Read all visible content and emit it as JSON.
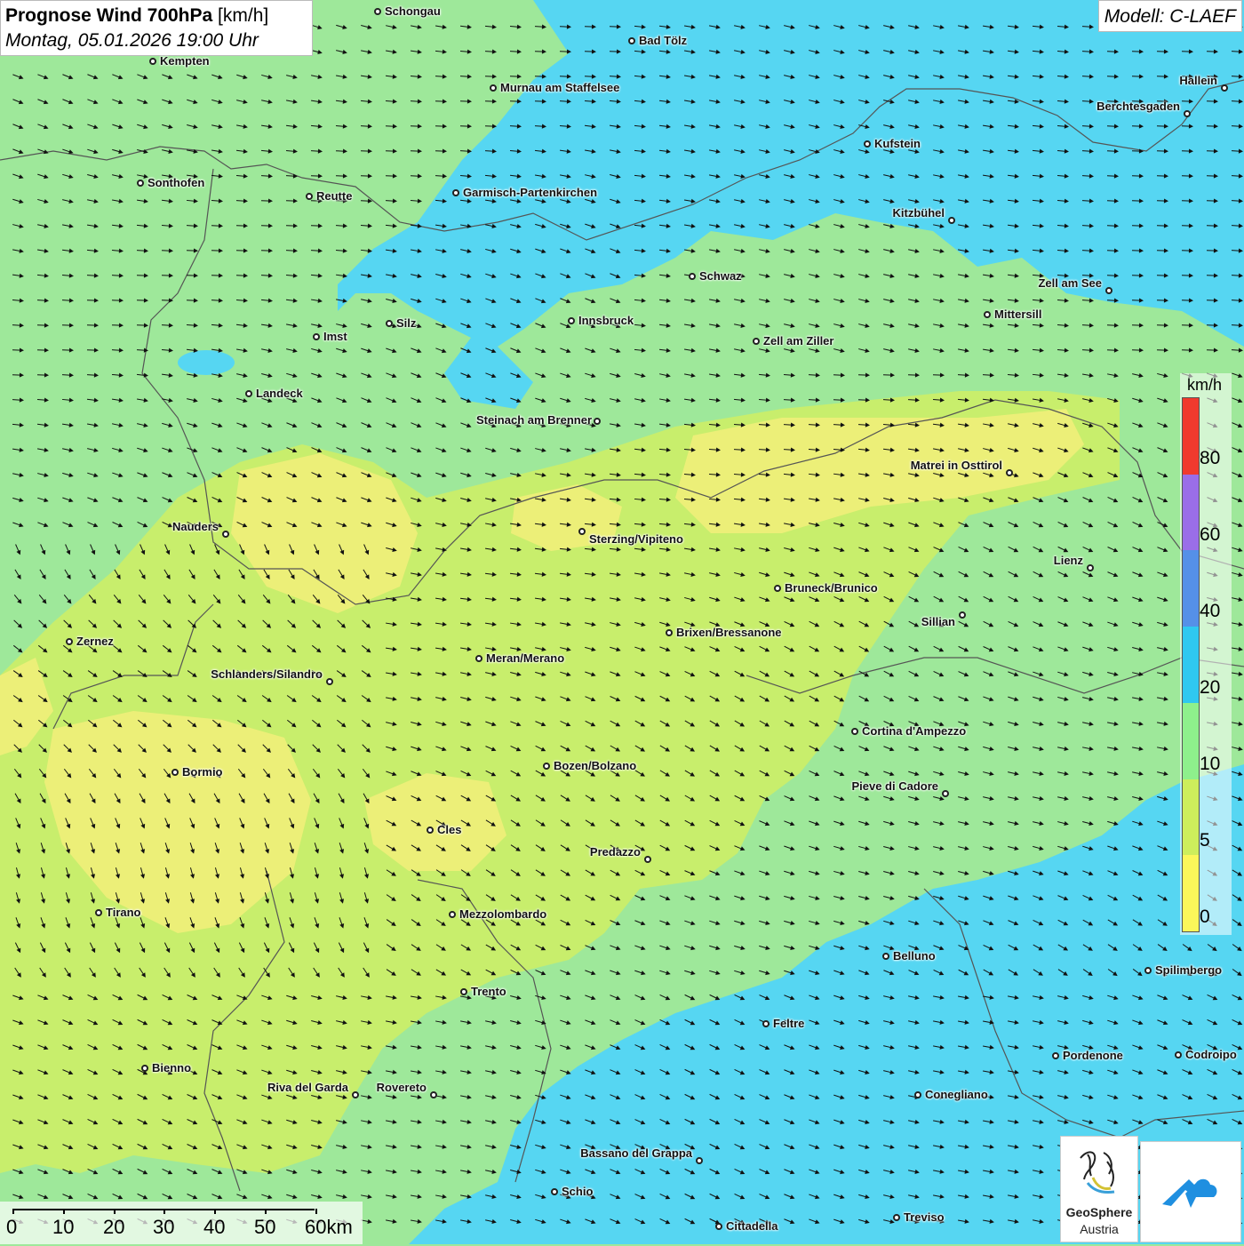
{
  "title": {
    "main": "Prognose Wind 700hPa",
    "unit": "[km/h]",
    "datetime": "Montag, 05.01.2026 19:00 Uhr"
  },
  "model": "Modell: C-LAEF",
  "legend": {
    "unit": "km/h",
    "ticks": [
      "80",
      "60",
      "40",
      "20",
      "10",
      "5",
      "0"
    ],
    "colors": [
      "#f03a2e",
      "#9a6ee8",
      "#5590e8",
      "#2fc8f0",
      "#8ef08c",
      "#cdee5c",
      "#fbf75a"
    ]
  },
  "colors": {
    "calm": "#ecef78",
    "light": "#c8ee6c",
    "moderate": "#9ee89a",
    "fresh": "#56d6f2"
  },
  "cities": [
    {
      "name": "Schongau"
    },
    {
      "name": "Bad Tölz"
    },
    {
      "name": "Kempten"
    },
    {
      "name": "Murnau am Staffelsee"
    },
    {
      "name": "Hallein"
    },
    {
      "name": "Berchtesgaden"
    },
    {
      "name": "Kufstein"
    },
    {
      "name": "Sonthofen"
    },
    {
      "name": "Reutte"
    },
    {
      "name": "Garmisch-Partenkirchen"
    },
    {
      "name": "Kitzbühel"
    },
    {
      "name": "Schwaz"
    },
    {
      "name": "Zell am See"
    },
    {
      "name": "Mittersill"
    },
    {
      "name": "Innsbruck"
    },
    {
      "name": "Silz"
    },
    {
      "name": "Imst"
    },
    {
      "name": "Zell am Ziller"
    },
    {
      "name": "Landeck"
    },
    {
      "name": "Steinach am Brenner"
    },
    {
      "name": "Matrei in Osttirol"
    },
    {
      "name": "Nauders"
    },
    {
      "name": "Sterzing/Vipiteno"
    },
    {
      "name": "Lienz"
    },
    {
      "name": "Bruneck/Brunico"
    },
    {
      "name": "Sillian"
    },
    {
      "name": "Zernez"
    },
    {
      "name": "Brixen/Bressanone"
    },
    {
      "name": "Meran/Merano"
    },
    {
      "name": "Schlanders/Silandro"
    },
    {
      "name": "Cortina d'Ampezzo"
    },
    {
      "name": "Bozen/Bolzano"
    },
    {
      "name": "Bormio"
    },
    {
      "name": "Pieve di Cadore"
    },
    {
      "name": "Cles"
    },
    {
      "name": "Predazzo"
    },
    {
      "name": "Tirano"
    },
    {
      "name": "Mezzolombardo"
    },
    {
      "name": "Belluno"
    },
    {
      "name": "Spilimbergo"
    },
    {
      "name": "Trento"
    },
    {
      "name": "Feltre"
    },
    {
      "name": "Pordenone"
    },
    {
      "name": "Codroipo"
    },
    {
      "name": "Bienno"
    },
    {
      "name": "Riva del Garda"
    },
    {
      "name": "Rovereto"
    },
    {
      "name": "Conegliano"
    },
    {
      "name": "Bassano del Grappa"
    },
    {
      "name": "Schio"
    },
    {
      "name": "Treviso"
    },
    {
      "name": "Cittadella"
    }
  ],
  "scale": {
    "labels": [
      "0",
      "10",
      "20",
      "30",
      "40",
      "50",
      "60km"
    ]
  },
  "logo": {
    "line1": "GeoSphere",
    "line2": "Austria"
  }
}
